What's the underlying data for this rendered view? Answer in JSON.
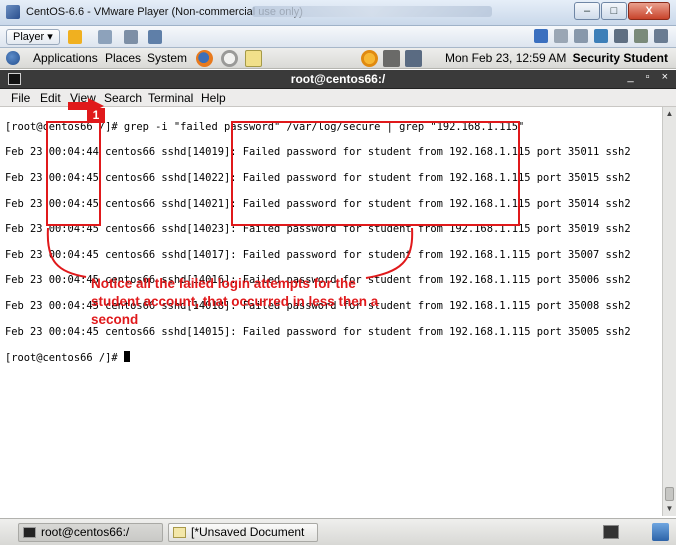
{
  "vm_window": {
    "title": "CentOS-6.6 - VMware Player (Non-commercial use only)",
    "buttons": [
      "–",
      "□",
      "X"
    ]
  },
  "vm_toolbar": {
    "player_label": "Player ▾"
  },
  "gnome_panel": {
    "menus": [
      "Applications",
      "Places",
      "System"
    ],
    "clock": "Mon Feb 23, 12:59 AM",
    "user": "Security Student"
  },
  "terminal": {
    "title": "root@centos66:/",
    "window_buttons": [
      "_",
      "▫",
      "×"
    ],
    "menu": [
      "File",
      "Edit",
      "View",
      "Search",
      "Terminal",
      "Help"
    ],
    "lines": [
      "[root@centos66 /]# grep -i \"failed password\" /var/log/secure | grep \"192.168.1.115\"",
      "Feb 23 00:04:44 centos66 sshd[14019]: Failed password for student from 192.168.1.115 port 35011 ssh2",
      "Feb 23 00:04:45 centos66 sshd[14022]: Failed password for student from 192.168.1.115 port 35015 ssh2",
      "Feb 23 00:04:45 centos66 sshd[14021]: Failed password for student from 192.168.1.115 port 35014 ssh2",
      "Feb 23 00:04:45 centos66 sshd[14023]: Failed password for student from 192.168.1.115 port 35019 ssh2",
      "Feb 23 00:04:45 centos66 sshd[14017]: Failed password for student from 192.168.1.115 port 35007 ssh2",
      "Feb 23 00:04:45 centos66 sshd[14016]: Failed password for student from 192.168.1.115 port 35006 ssh2",
      "Feb 23 00:04:45 centos66 sshd[14018]: Failed password for student from 192.168.1.115 port 35008 ssh2",
      "Feb 23 00:04:45 centos66 sshd[14015]: Failed password for student from 192.168.1.115 port 35005 ssh2"
    ],
    "prompt": "[root@centos66 /]# "
  },
  "annotation": {
    "step_number": "1",
    "note": "Notice all the failed login attempts for the student account, that occurred in less then a second",
    "color": "#e0191b"
  },
  "taskbar": {
    "items": [
      "root@centos66:/",
      "[*Unsaved Document ..."
    ]
  }
}
